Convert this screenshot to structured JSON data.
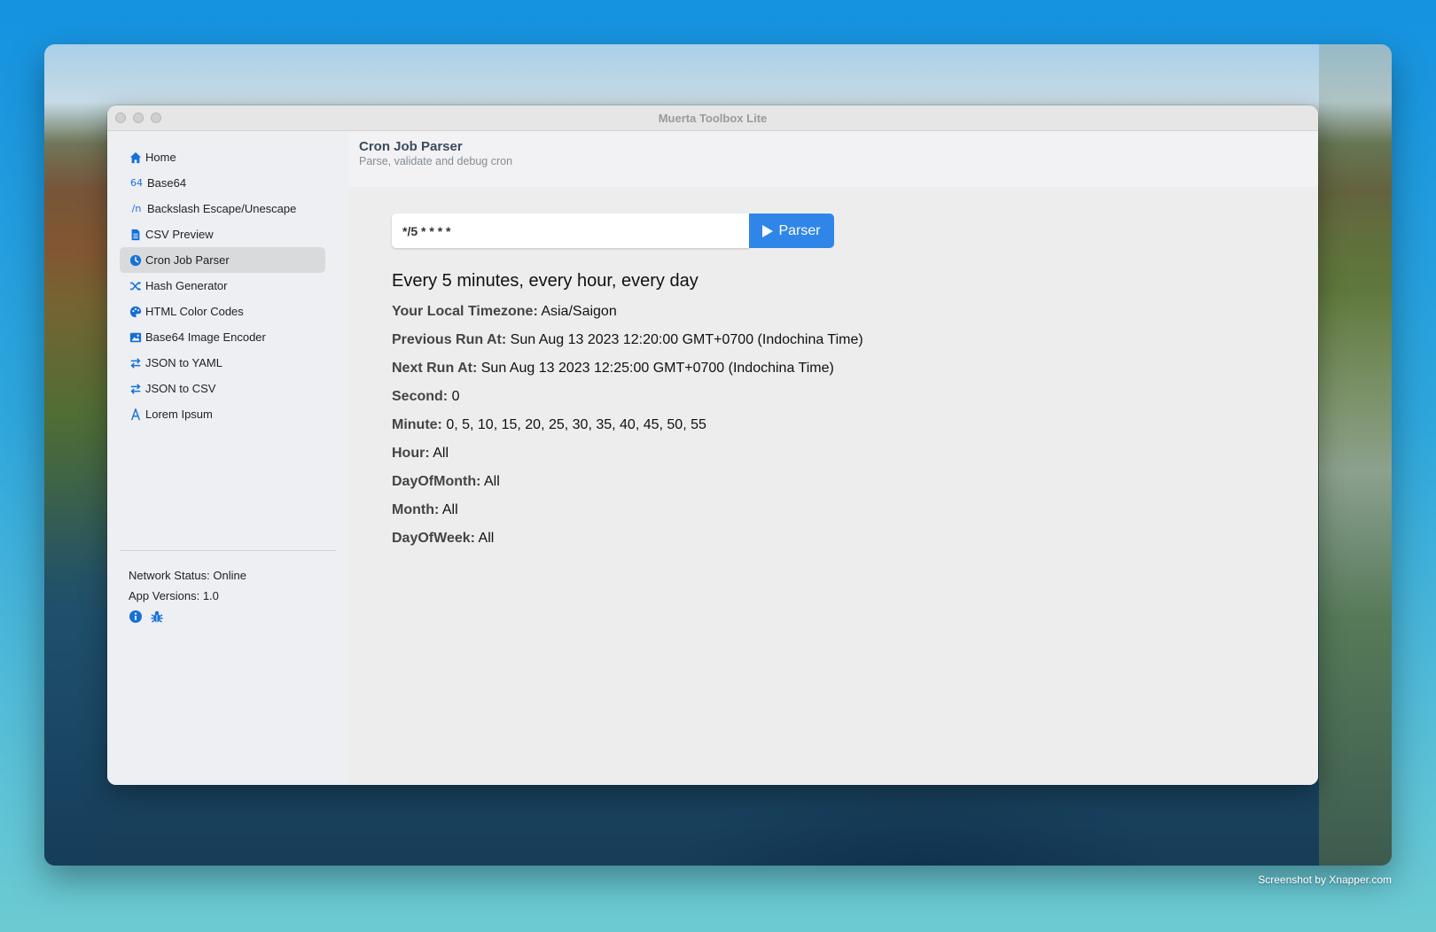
{
  "window": {
    "title": "Muerta Toolbox Lite"
  },
  "sidebar": {
    "items": [
      {
        "label": "Home",
        "icon": "home-icon",
        "active": false
      },
      {
        "label": "Base64",
        "icon": "base64-icon",
        "icon_text": "64",
        "active": false
      },
      {
        "label": "Backslash Escape/Unescape",
        "icon": "backslash-icon",
        "icon_text": "/n",
        "active": false
      },
      {
        "label": "CSV Preview",
        "icon": "file-icon",
        "active": false
      },
      {
        "label": "Cron Job Parser",
        "icon": "clock-icon",
        "active": true
      },
      {
        "label": "Hash Generator",
        "icon": "shuffle-icon",
        "active": false
      },
      {
        "label": "HTML Color Codes",
        "icon": "palette-icon",
        "active": false
      },
      {
        "label": "Base64 Image Encoder",
        "icon": "image-icon",
        "active": false
      },
      {
        "label": "JSON to YAML",
        "icon": "swap-icon",
        "active": false
      },
      {
        "label": "JSON to CSV",
        "icon": "swap-icon",
        "active": false
      },
      {
        "label": "Lorem Ipsum",
        "icon": "font-icon",
        "active": false
      }
    ],
    "network_status": "Network Status: Online",
    "app_version": "App Versions: 1.0",
    "footer_icons": [
      "info-icon",
      "bug-icon"
    ]
  },
  "header": {
    "title": "Cron Job Parser",
    "subtitle": "Parse, validate and debug cron"
  },
  "form": {
    "input_value": "*/5 * * * *",
    "button_label": "Parser"
  },
  "result": {
    "summary": "Every 5 minutes, every hour, every day",
    "fields": [
      {
        "key": "Your Local Timezone:",
        "value": "Asia/Saigon"
      },
      {
        "key": "Previous Run At:",
        "value": "Sun Aug 13 2023 12:20:00 GMT+0700 (Indochina Time)"
      },
      {
        "key": "Next Run At:",
        "value": "Sun Aug 13 2023 12:25:00 GMT+0700 (Indochina Time)"
      },
      {
        "key": "Second:",
        "value": "0"
      },
      {
        "key": "Minute:",
        "value": "0, 5, 10, 15, 20, 25, 30, 35, 40, 45, 50, 55"
      },
      {
        "key": "Hour:",
        "value": "All"
      },
      {
        "key": "DayOfMonth:",
        "value": "All"
      },
      {
        "key": "Month:",
        "value": "All"
      },
      {
        "key": "DayOfWeek:",
        "value": "All"
      }
    ]
  },
  "credit": "Screenshot by Xnapper.com",
  "colors": {
    "accent": "#2f86e8",
    "icon": "#1670d8",
    "active_bg": "#d9dadc"
  }
}
